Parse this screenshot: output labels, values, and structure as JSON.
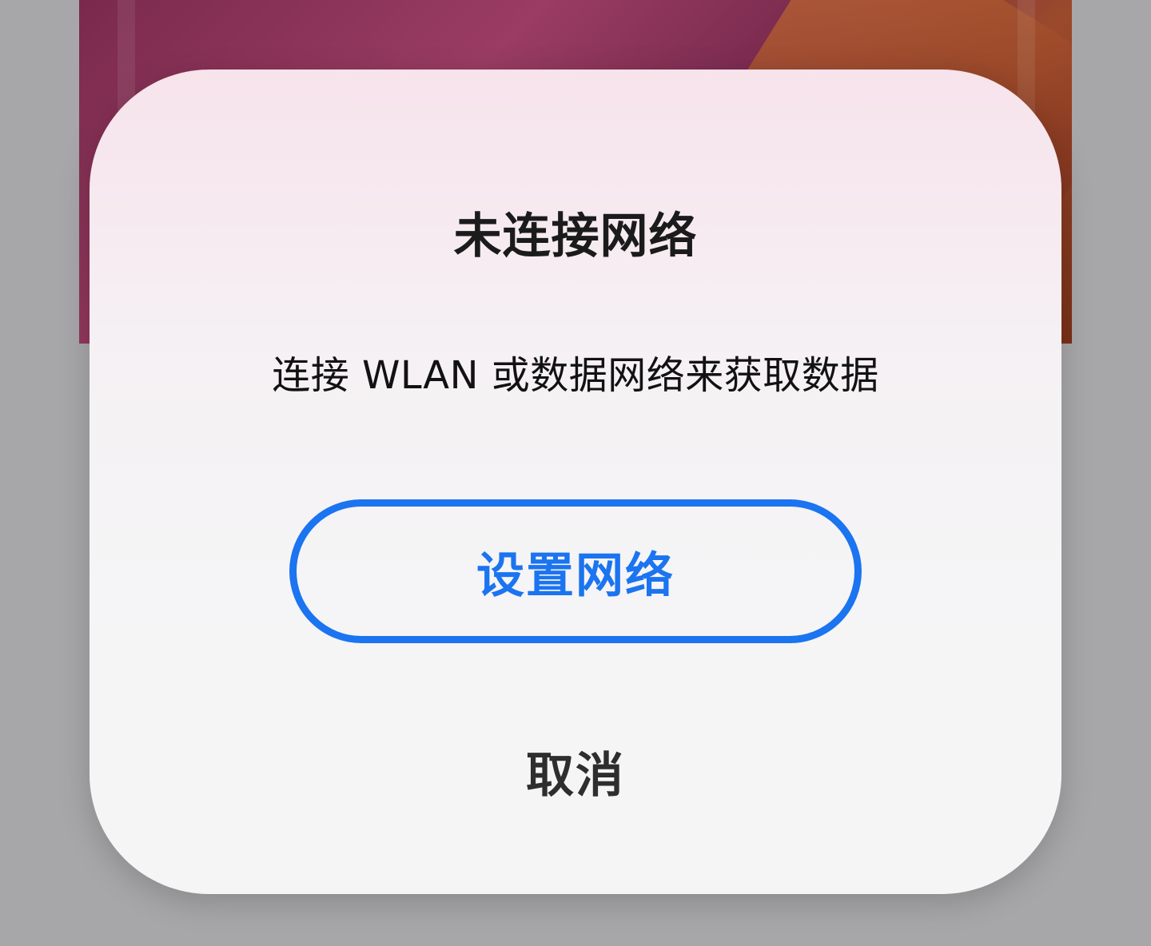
{
  "dialog": {
    "title": "未连接网络",
    "message": "连接 WLAN 或数据网络来获取数据",
    "primary_button_label": "设置网络",
    "cancel_button_label": "取消"
  },
  "colors": {
    "primary": "#1b74f0",
    "overlay": "#a7a7a9",
    "dialog_bg": "#f5f5f6",
    "text": "#121212"
  }
}
